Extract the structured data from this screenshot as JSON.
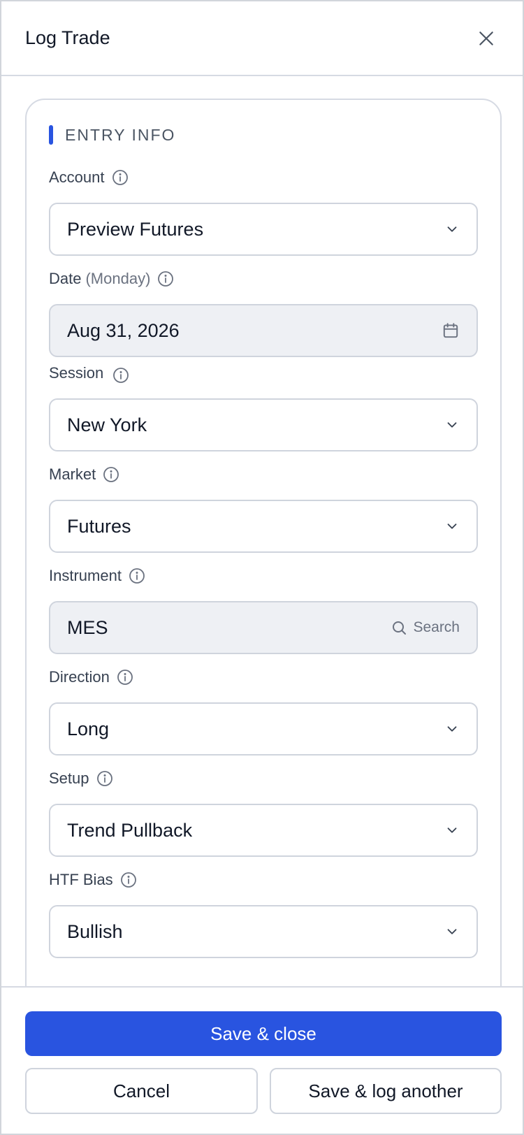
{
  "header": {
    "title": "Log Trade"
  },
  "section": {
    "title": "ENTRY INFO"
  },
  "fields": {
    "account": {
      "label": "Account",
      "value": "Preview Futures"
    },
    "date": {
      "label": "Date",
      "label_extra": "(Monday)",
      "value": "Aug 31, 2026"
    },
    "session": {
      "label": "Session",
      "value": "New York"
    },
    "market": {
      "label": "Market",
      "value": "Futures"
    },
    "instrument": {
      "label": "Instrument",
      "value": "MES",
      "search_label": "Search"
    },
    "direction": {
      "label": "Direction",
      "value": "Long"
    },
    "setup": {
      "label": "Setup",
      "value": "Trend Pullback"
    },
    "htf_bias": {
      "label": "HTF Bias",
      "value": "Bullish"
    }
  },
  "footer": {
    "save_close": "Save & close",
    "cancel": "Cancel",
    "save_another": "Save & log another"
  },
  "colors": {
    "accent": "#2954e0",
    "border": "#cfd4dd",
    "filled_bg": "#eef0f4"
  }
}
